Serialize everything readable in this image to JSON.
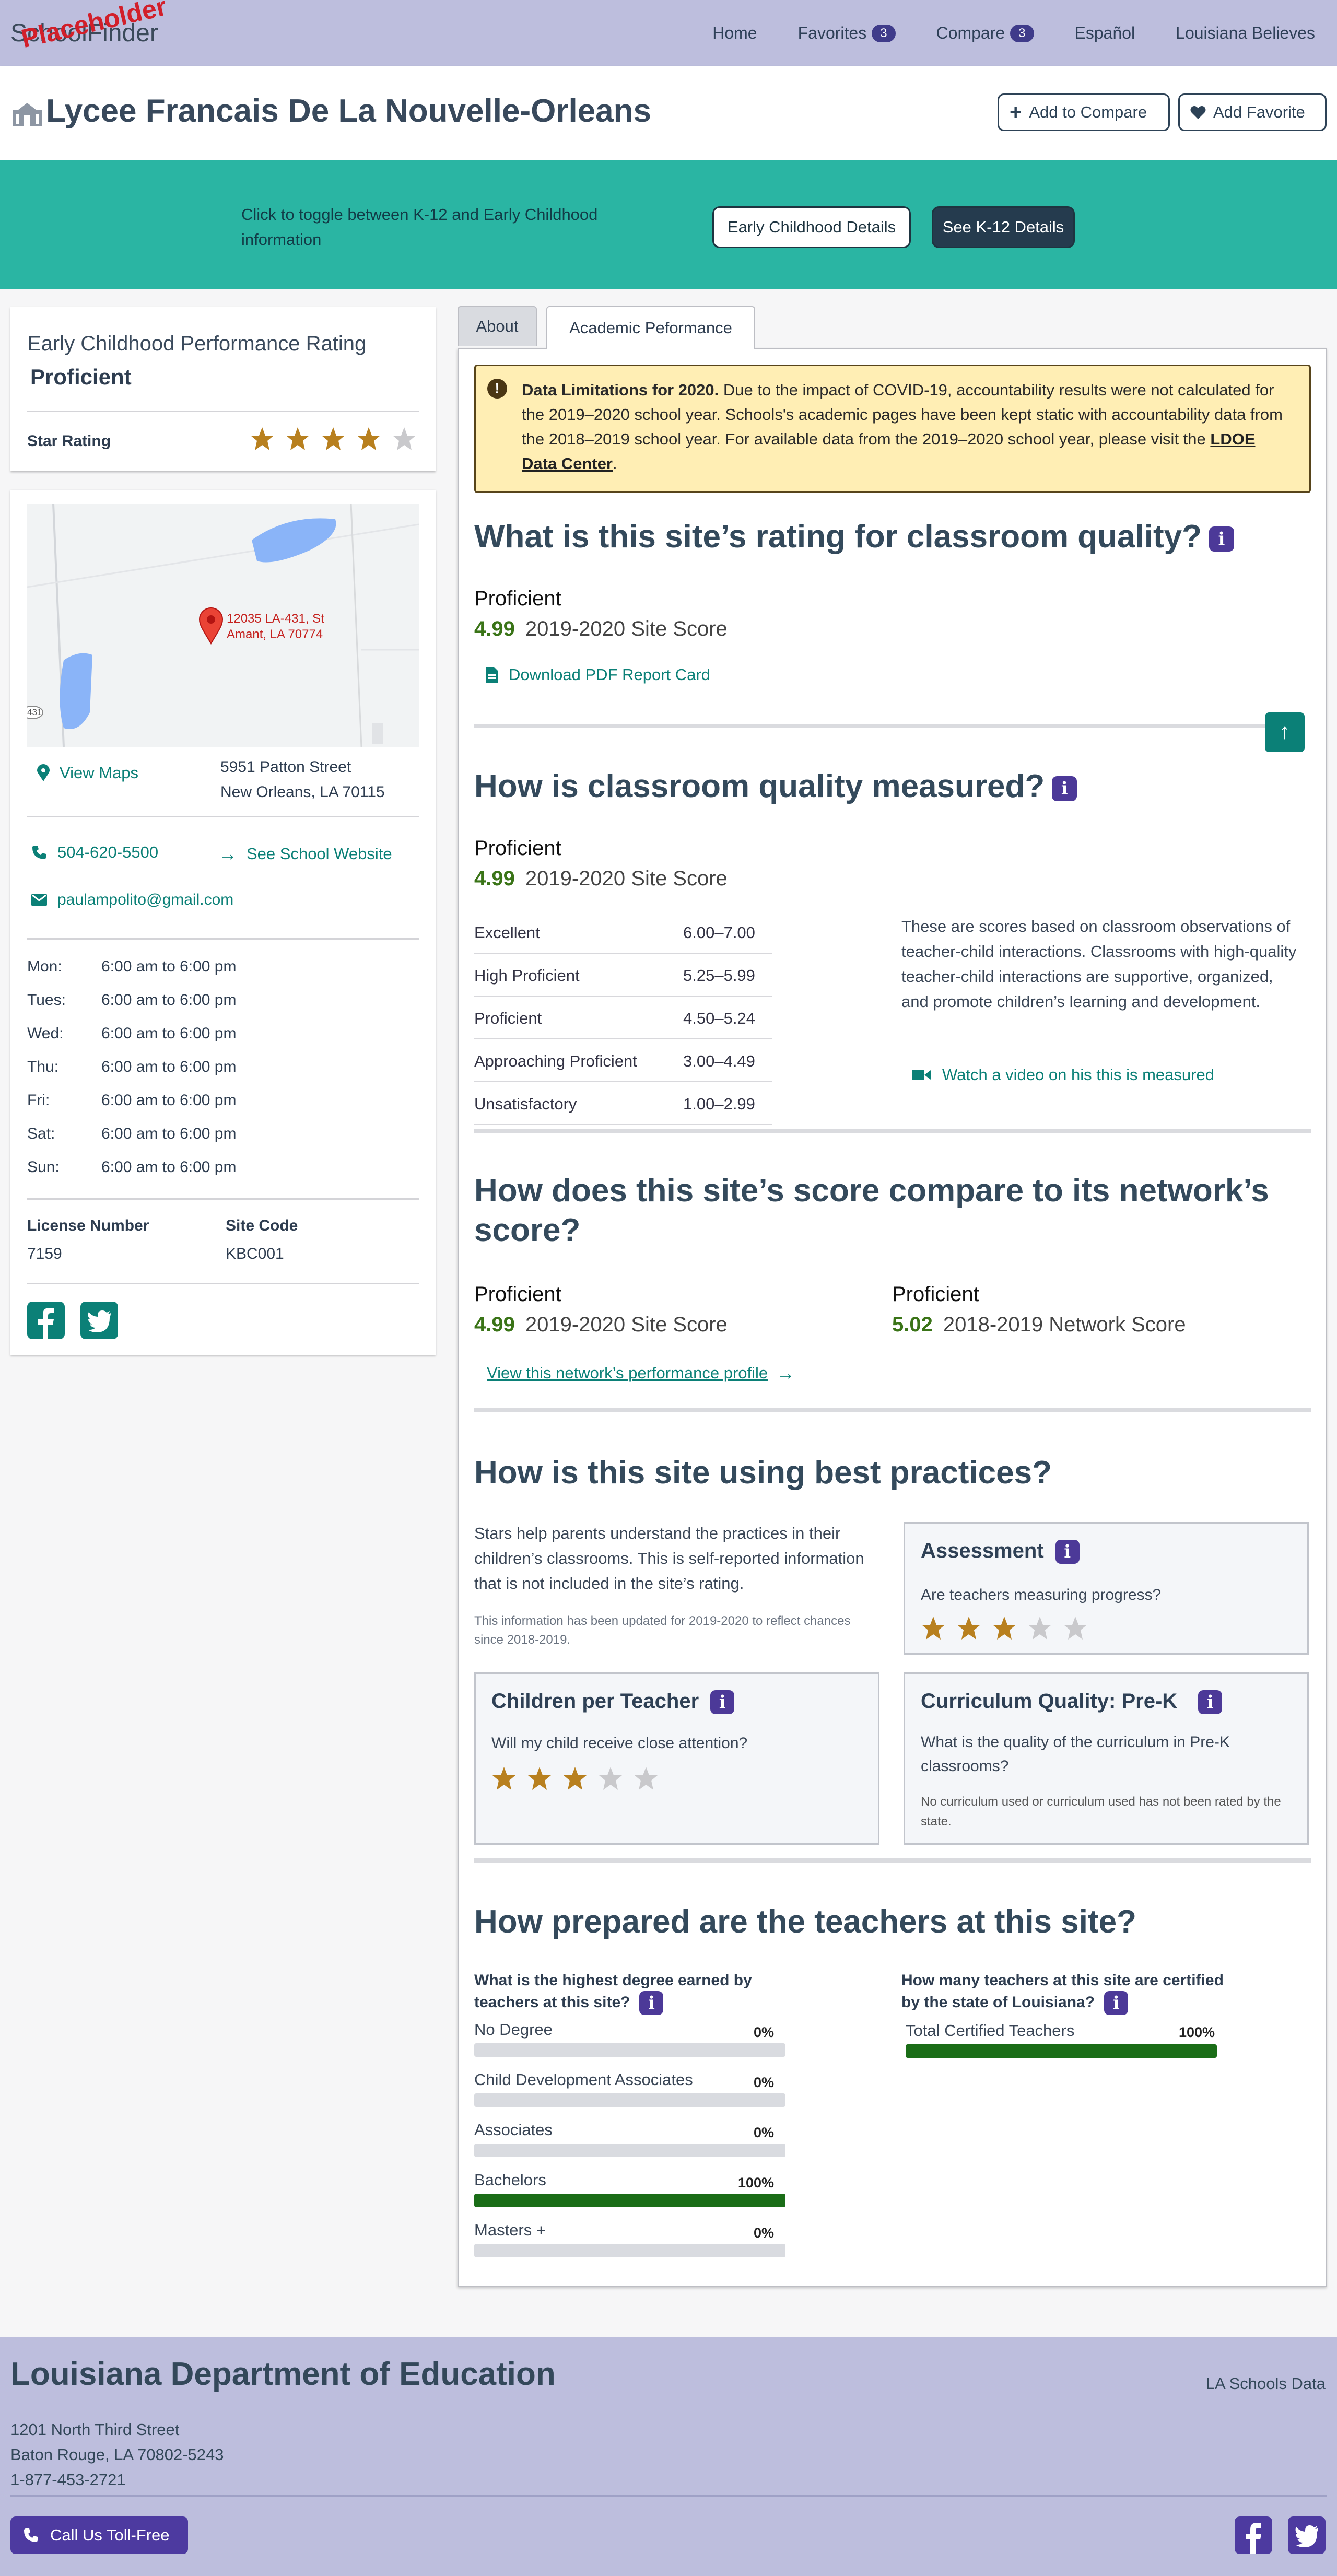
{
  "nav": {
    "logo": "SchoolFinder",
    "placeholder": "Placeholder",
    "links": [
      "Home",
      "Favorites",
      "Compare",
      "Español",
      "Louisiana Believes"
    ],
    "favorites_count": "3",
    "compare_count": "3"
  },
  "school": {
    "name": "Lycee Francais De La Nouvelle-Orleans",
    "add_compare": "Add to Compare",
    "add_favorite": "Add Favorite"
  },
  "toggle": {
    "text": "Click to toggle between K-12 and Early Childhood information",
    "early_btn": "Early Childhood Details",
    "k12_btn": "See K-12 Details"
  },
  "sidebar": {
    "rating_title": "Early Childhood Performance Rating",
    "rating_value": "Proficient",
    "star_label": "Star Rating",
    "stars": 4,
    "map_address": "12035 LA-431, St Amant, LA 70774",
    "map_route": "431",
    "view_maps": "View Maps",
    "address1": "5951 Patton Street",
    "address2": "New Orleans, LA 70115",
    "phone": "504-620-5500",
    "website": "See School Website",
    "email": "paulampolito@gmail.com",
    "hours": [
      {
        "day": "Mon:",
        "time": "6:00 am to 6:00 pm"
      },
      {
        "day": "Tues:",
        "time": "6:00 am to 6:00 pm"
      },
      {
        "day": "Wed:",
        "time": "6:00 am to 6:00 pm"
      },
      {
        "day": "Thu:",
        "time": "6:00 am to 6:00 pm"
      },
      {
        "day": "Fri:",
        "time": "6:00 am to 6:00 pm"
      },
      {
        "day": "Sat:",
        "time": "6:00 am to 6:00 pm"
      },
      {
        "day": "Sun:",
        "time": "6:00 am to 6:00 pm"
      }
    ],
    "license_label": "License Number",
    "license_value": "7159",
    "sitecode_label": "Site Code",
    "sitecode_value": "KBC001"
  },
  "tabs": [
    "About",
    "Academic Peformance"
  ],
  "alert": {
    "title": "Data Limitations for 2020.",
    "body": "Due to the impact of COVID-19, accountability results were not calculated for the 2019–2020 school year. Schools's academic pages have been kept static with accountability data from the 2018–2019 school year. For available data from the 2019–2020 school year, please visit the",
    "link": "LDOE Data Center",
    "end": "."
  },
  "s1": {
    "title": "What is this site’s rating for classroom quality?",
    "rating": "Proficient",
    "score": "4.99",
    "score_label": "2019-2020 Site Score",
    "download": "Download PDF Report Card"
  },
  "s2": {
    "title": "How is classroom quality  measured?",
    "rating": "Proficient",
    "score": "4.99",
    "score_label": "2019-2020 Site Score",
    "rows": [
      {
        "label": "Excellent",
        "range": "6.00–7.00"
      },
      {
        "label": "High Proficient",
        "range": "5.25–5.99"
      },
      {
        "label": "Proficient",
        "range": "4.50–5.24"
      },
      {
        "label": "Approaching Proficient",
        "range": "3.00–4.49"
      },
      {
        "label": "Unsatisfactory",
        "range": "1.00–2.99"
      }
    ],
    "desc": "These are scores based on classroom observations of teacher-child interactions. Classrooms with high-quality teacher-child interactions are supportive, organized, and promote children’s learning and development.",
    "video": "Watch a video on his this is measured"
  },
  "s3": {
    "title": "How does this site’s score compare to its network’s score?",
    "site_rating": "Proficient",
    "site_score": "4.99",
    "site_label": "2019-2020 Site Score",
    "net_rating": "Proficient",
    "net_score": "5.02",
    "net_label": "2018-2019 Network Score",
    "link": "View this network’s performance profile"
  },
  "s4": {
    "title": "How is this site using best practices?",
    "intro": "Stars help parents understand the practices in their children’s classrooms. This is self-reported information that is not included in the site’s rating.",
    "note": "This information has been updated for 2019-2020 to reflect chances since 2018-2019.",
    "assessment_title": "Assessment",
    "assessment_q": "Are teachers measuring progress?",
    "assessment_stars": 3,
    "cpt_title": "Children per Teacher",
    "cpt_q": "Will my child receive close attention?",
    "cpt_stars": 3,
    "cq_title": "Curriculum Quality: Pre-K",
    "cq_q": "What is the quality of the curriculum in Pre-K classrooms?",
    "cq_note": "No curriculum used or curriculum used has not been rated by the state."
  },
  "s5": {
    "title": "How prepared are the teachers at this site?",
    "deg_q": "What is the highest degree earned by teachers at this site?",
    "degrees": [
      {
        "label": "No Degree",
        "pct": "0%",
        "value": 0
      },
      {
        "label": "Child Development Associates",
        "pct": "0%",
        "value": 0
      },
      {
        "label": "Associates",
        "pct": "0%",
        "value": 0
      },
      {
        "label": "Bachelors",
        "pct": "100%",
        "value": 100
      },
      {
        "label": "Masters +",
        "pct": "0%",
        "value": 0
      }
    ],
    "cert_q": "How many teachers at this site are certified by the state of Louisiana?",
    "cert_label": "Total Certified Teachers",
    "cert_pct": "100%",
    "cert_value": 100
  },
  "footer": {
    "title": "Louisiana Department of Education",
    "data_link": "LA Schools Data",
    "line1": "1201 North Third Street",
    "line2": "Baton Rouge, LA 70802-5243",
    "line3": "1-877-453-2721",
    "call": "Call Us Toll-Free"
  },
  "colors": {
    "nav_bg": "#bdbedd",
    "teal_band": "#2ab5a3",
    "star_gold": "#b8801f",
    "star_empty": "#c9c9cc",
    "green_score": "#3a7417",
    "bar_fill": "#1a6d17",
    "info_purple": "#4c3998"
  }
}
